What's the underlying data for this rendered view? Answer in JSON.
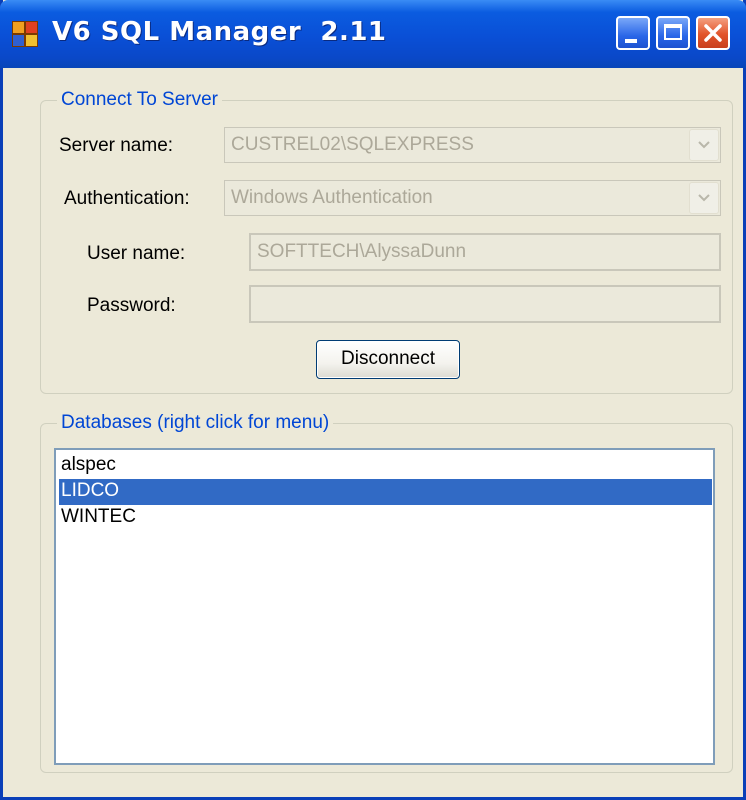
{
  "window": {
    "title": "V6 SQL Manager  2.11",
    "icon": "app-icon",
    "controls": [
      "minimize-icon",
      "maximize-icon",
      "close-icon"
    ]
  },
  "connect": {
    "group_title": "Connect To Server",
    "server_label": "Server name:",
    "server_value": "CUSTREL02\\SQLEXPRESS",
    "auth_label": "Authentication:",
    "auth_value": "Windows Authentication",
    "user_label": "User name:",
    "user_value": "SOFTTECH\\AlyssaDunn",
    "password_label": "Password:",
    "password_value": "",
    "disconnect_label": "Disconnect"
  },
  "databases": {
    "group_title": "Databases (right click for menu)",
    "items": [
      {
        "label": "alspec"
      },
      {
        "label": "LIDCO"
      },
      {
        "label": "WINTEC"
      }
    ],
    "selected": "LIDCO"
  },
  "colors": {
    "title_bar": "#0a4fd6",
    "group_title": "#0046d5",
    "selection": "#316ac5",
    "disabled_text": "#aca899"
  }
}
